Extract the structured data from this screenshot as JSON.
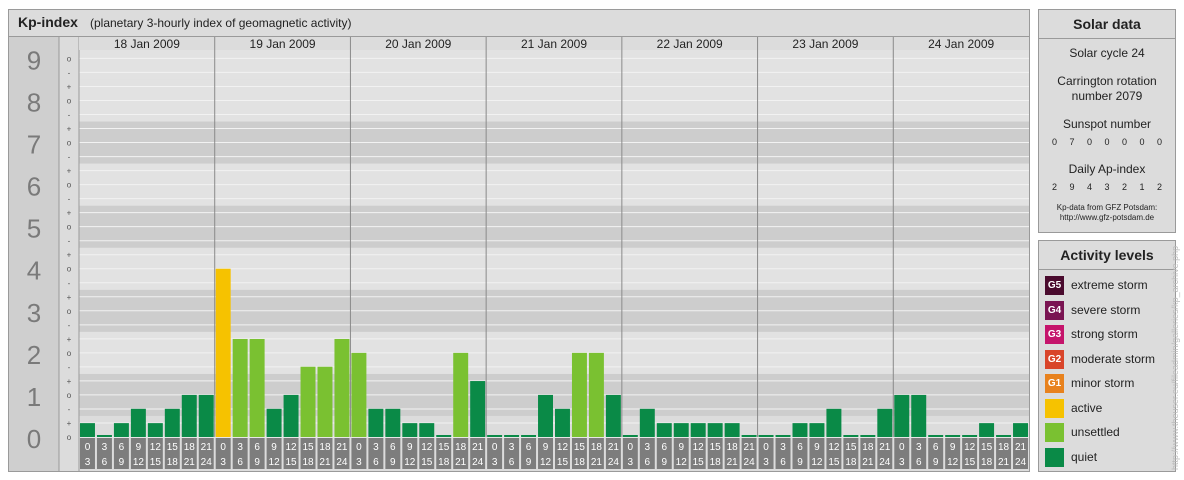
{
  "header": {
    "title": "Kp-index",
    "subtitle": "(planetary 3-hourly index of geomagnetic activity)"
  },
  "chart_data": {
    "type": "bar",
    "title": "Kp-index",
    "ylim": [
      0,
      9
    ],
    "y_major_labels": [
      "0",
      "1",
      "2",
      "3",
      "4",
      "5",
      "6",
      "7",
      "8",
      "9"
    ],
    "y_minor_labels": [
      "o",
      "-",
      "+"
    ],
    "days": [
      "18 Jan 2009",
      "19 Jan 2009",
      "20 Jan 2009",
      "21 Jan 2009",
      "22 Jan 2009",
      "23 Jan 2009",
      "24 Jan 2009"
    ],
    "interval_start_labels": [
      "0",
      "3",
      "6",
      "9",
      "12",
      "15",
      "18",
      "21"
    ],
    "interval_end_labels": [
      "3",
      "6",
      "9",
      "12",
      "15",
      "18",
      "21",
      "24"
    ],
    "values": [
      [
        0.33,
        0,
        0.33,
        0.67,
        0.33,
        0.67,
        1,
        1
      ],
      [
        4,
        2.33,
        2.33,
        0.67,
        1,
        1.67,
        1.67,
        2.33
      ],
      [
        2,
        0.67,
        0.67,
        0.33,
        0.33,
        0,
        2,
        1.33
      ],
      [
        0,
        0,
        0,
        1,
        0.67,
        2,
        2,
        1
      ],
      [
        0,
        0.67,
        0.33,
        0.33,
        0.33,
        0.33,
        0.33,
        0
      ],
      [
        0,
        0,
        0.33,
        0.33,
        0.67,
        0,
        0,
        0.67
      ],
      [
        1,
        1,
        0,
        0,
        0,
        0.33,
        0,
        0.33
      ]
    ],
    "thresholds": {
      "unsettled": 1.67,
      "active": 3.67,
      "minor_storm": 4.67
    },
    "colors": {
      "quiet": "#0a8a47",
      "unsettled": "#7ac131",
      "active": "#f6c200",
      "minor_storm": "#e8821e",
      "moderate_storm": "#d9452a",
      "strong_storm": "#c5146b",
      "severe_storm": "#7a1452",
      "extreme_storm": "#4a0b2e"
    }
  },
  "solar": {
    "heading": "Solar data",
    "cycle": "Solar cycle 24",
    "carrington_line1": "Carrington rotation",
    "carrington_line2": "number 2079",
    "sunspot_label": "Sunspot number",
    "sunspot_values": "0 7 0 0 0 0 0",
    "ap_label": "Daily Ap-index",
    "ap_values": "2 9 4 3 2 1 2",
    "source_line1": "Kp-data from GFZ Potsdam:",
    "source_line2": "http://www.gfz-potsdam.de"
  },
  "activity": {
    "heading": "Activity levels",
    "levels": [
      {
        "badge": "G5",
        "label": "extreme storm",
        "color": "#4a0b2e"
      },
      {
        "badge": "G4",
        "label": "severe storm",
        "color": "#7a1452"
      },
      {
        "badge": "G3",
        "label": "strong storm",
        "color": "#c5146b"
      },
      {
        "badge": "G2",
        "label": "moderate storm",
        "color": "#d9452a"
      },
      {
        "badge": "G1",
        "label": "minor storm",
        "color": "#e8821e"
      },
      {
        "badge": "",
        "label": "active",
        "color": "#f6c200"
      },
      {
        "badge": "",
        "label": "unsettled",
        "color": "#7ac131"
      },
      {
        "badge": "",
        "label": "quiet",
        "color": "#0a8a47"
      }
    ]
  },
  "watermark": "http://www.theuser.eu/fileadmin/galleries/kp_archive.php"
}
